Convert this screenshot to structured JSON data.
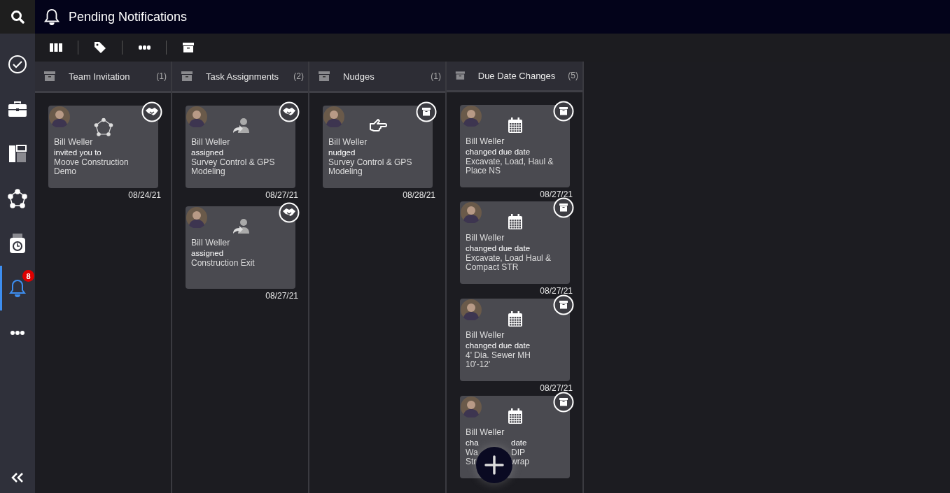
{
  "header": {
    "title": "Pending Notifications"
  },
  "sidebar": {
    "items": [
      {
        "kind": "tasks",
        "selected": false
      },
      {
        "kind": "projects",
        "selected": false
      },
      {
        "kind": "board",
        "selected": false
      },
      {
        "kind": "network",
        "selected": false
      },
      {
        "kind": "timeclock",
        "selected": false
      },
      {
        "kind": "notifications",
        "selected": true,
        "badge": "8"
      },
      {
        "kind": "more",
        "selected": false
      }
    ]
  },
  "columns": [
    {
      "title": "Team Invitation",
      "count": "(1)",
      "cards": [
        {
          "kind": "invite",
          "name": "Bill Weller",
          "action": "invited you to",
          "title": "Moove Construction Demo",
          "date": "08/24/21"
        }
      ]
    },
    {
      "title": "Task Assignments",
      "count": "(2)",
      "cards": [
        {
          "kind": "assign",
          "name": "Bill Weller",
          "action": "assigned",
          "title": "Survey Control & GPS Modeling",
          "date": "08/27/21"
        },
        {
          "kind": "assign",
          "name": "Bill Weller",
          "action": "assigned",
          "title": "Construction Exit",
          "date": "08/27/21"
        }
      ]
    },
    {
      "title": "Nudges",
      "count": "(1)",
      "cards": [
        {
          "kind": "nudge",
          "name": "Bill Weller",
          "action": "nudged",
          "title": "Survey Control & GPS Modeling",
          "date": "08/28/21"
        }
      ]
    },
    {
      "title": "Due Date Changes",
      "count": "(5)",
      "cards": [
        {
          "kind": "due_date",
          "name": "Bill Weller",
          "action": "changed due date",
          "title": "Excavate, Load, Haul & Place NS",
          "date": "08/27/21"
        },
        {
          "kind": "due_date",
          "name": "Bill Weller",
          "action": "changed due date",
          "title": "Excavate, Load Haul & Compact STR",
          "date": "08/27/21"
        },
        {
          "kind": "due_date",
          "name": "Bill Weller",
          "action": "changed due date",
          "title": "4' Dia. Sewer MH 10'-12'",
          "date": "08/27/21"
        },
        {
          "kind": "due_date",
          "name": "Bill Weller",
          "action_parts": [
            "cha",
            "date"
          ],
          "title_lines": [
            [
              "Wa",
              "DIP"
            ],
            [
              "Str",
              "wrap"
            ]
          ]
        }
      ]
    }
  ]
}
